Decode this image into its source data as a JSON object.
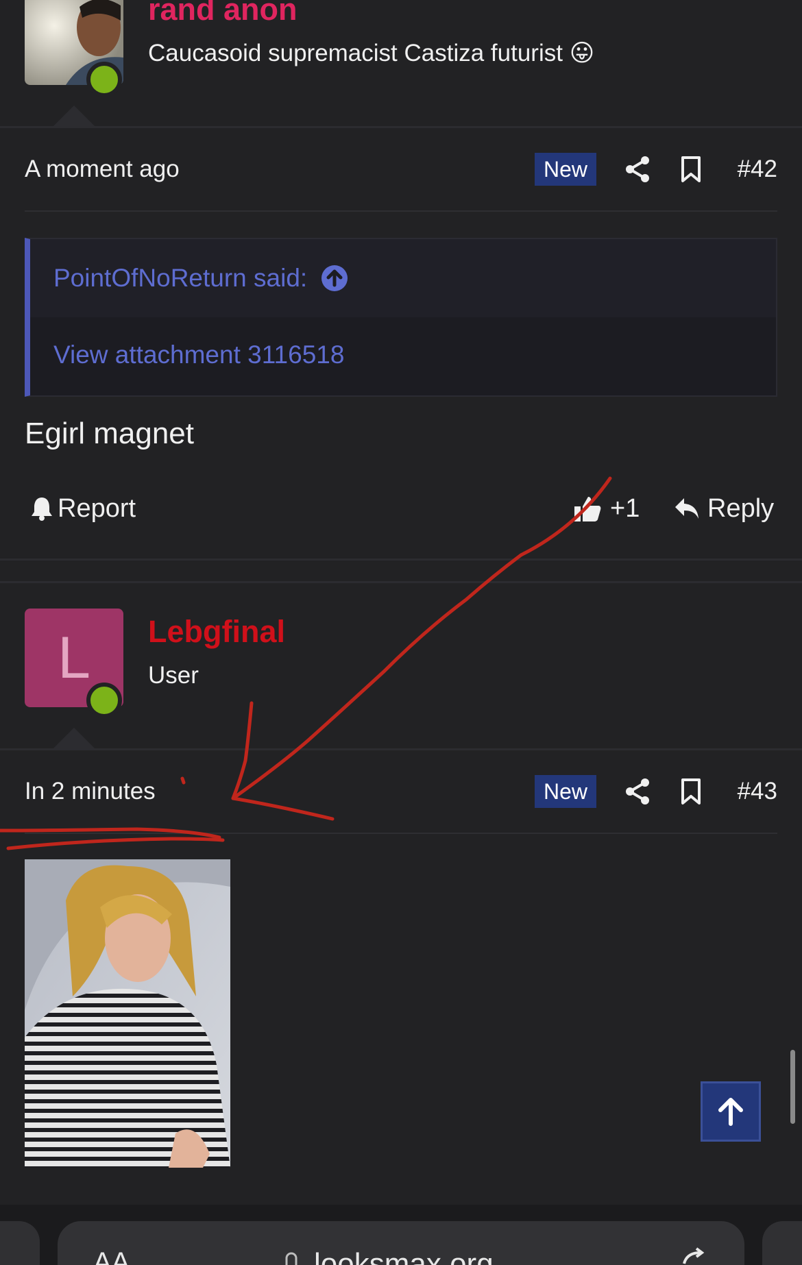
{
  "post42_author": {
    "name": "rand anon",
    "title": "Caucasoid supremacist Castiza futurist 😛"
  },
  "post42": {
    "time": "A moment ago",
    "badge": "New",
    "number": "#42",
    "quote": {
      "author_line": "PointOfNoReturn said:",
      "attachment": "View attachment 3116518"
    },
    "text": "Egirl magnet",
    "actions": {
      "report": "Report",
      "reactions": "+1",
      "reply": "Reply"
    }
  },
  "post43_author": {
    "avatar_letter": "L",
    "name": "Lebgfinal",
    "title": "User"
  },
  "post43": {
    "time": "In 2 minutes",
    "badge": "New",
    "number": "#43"
  },
  "browser": {
    "aa": "AA",
    "url": "looksmax.org"
  },
  "colors": {
    "accent_name_1": "#e0255f",
    "accent_name_2": "#d0101a",
    "badge_bg": "#23377a",
    "quote_link": "#5e6dd1",
    "online": "#7cb319",
    "annotation": "#c0261c"
  },
  "icons": [
    "share-icon",
    "bookmark-icon",
    "bell-icon",
    "thumbs-up-icon",
    "reply-icon",
    "arrow-up-icon",
    "lock-icon",
    "reload-icon"
  ]
}
